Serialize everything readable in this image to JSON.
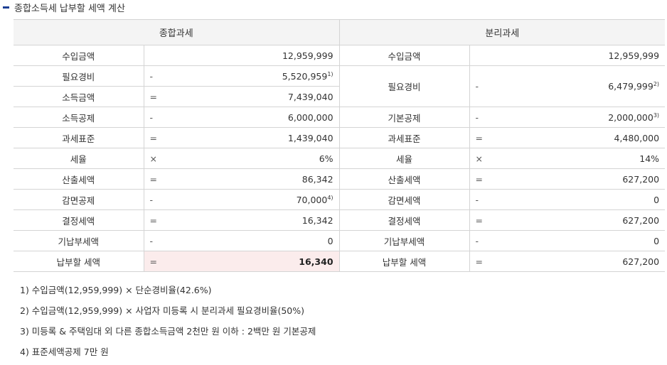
{
  "title": "종합소득세 납부할 세액 계산",
  "headers": {
    "left": "종합과세",
    "right": "분리과세"
  },
  "rows": [
    {
      "l_label": "수입금액",
      "l_op": "",
      "l_val": "12,959,999",
      "l_sup": "",
      "r_label": "수입금액",
      "r_op": "",
      "r_val": "12,959,999",
      "r_sup": ""
    },
    {
      "l_label": "필요경비",
      "l_op": "-",
      "l_val": "5,520,959",
      "l_sup": "1)",
      "r_label": "필요경비",
      "r_op": "-",
      "r_val": "6,479,999",
      "r_sup": "2)"
    },
    {
      "l_label": "소득금액",
      "l_op": "=",
      "l_val": "7,439,040",
      "l_sup": ""
    },
    {
      "l_label": "소득공제",
      "l_op": "-",
      "l_val": "6,000,000",
      "l_sup": "",
      "r_label": "기본공제",
      "r_op": "-",
      "r_val": "2,000,000",
      "r_sup": "3)"
    },
    {
      "l_label": "과세표준",
      "l_op": "=",
      "l_val": "1,439,040",
      "l_sup": "",
      "r_label": "과세표준",
      "r_op": "=",
      "r_val": "4,480,000",
      "r_sup": ""
    },
    {
      "l_label": "세율",
      "l_op": "×",
      "l_val": "6%",
      "l_sup": "",
      "r_label": "세율",
      "r_op": "×",
      "r_val": "14%",
      "r_sup": ""
    },
    {
      "l_label": "산출세액",
      "l_op": "=",
      "l_val": "86,342",
      "l_sup": "",
      "r_label": "산출세액",
      "r_op": "=",
      "r_val": "627,200",
      "r_sup": ""
    },
    {
      "l_label": "감면공제",
      "l_op": "-",
      "l_val": "70,000",
      "l_sup": "4)",
      "r_label": "감면세액",
      "r_op": "-",
      "r_val": "0",
      "r_sup": ""
    },
    {
      "l_label": "결정세액",
      "l_op": "=",
      "l_val": "16,342",
      "l_sup": "",
      "r_label": "결정세액",
      "r_op": "=",
      "r_val": "627,200",
      "r_sup": ""
    },
    {
      "l_label": "기납부세액",
      "l_op": "-",
      "l_val": "0",
      "l_sup": "",
      "r_label": "기납부세액",
      "r_op": "-",
      "r_val": "0",
      "r_sup": ""
    },
    {
      "l_label": "납부할 세액",
      "l_op": "=",
      "l_val": "16,340",
      "l_sup": "",
      "r_label": "납부할 세액",
      "r_op": "=",
      "r_val": "627,200",
      "r_sup": ""
    }
  ],
  "notes": [
    "1) 수입금액(12,959,999) × 단순경비율(42.6%)",
    "2) 수입금액(12,959,999) × 사업자 미등록 시 분리과세 필요경비율(50%)",
    "3) 미등록 & 주택임대 외 다른 종합소득금액 2천만 원 이하 : 2백만 원 기본공제",
    "4) 표준세액공제 7만 원"
  ],
  "colors": {
    "accent_bar": "#1c3f94",
    "header_bg": "#f4f4f4",
    "highlight_bg": "#fbecec",
    "border": "#d4d4d4"
  }
}
